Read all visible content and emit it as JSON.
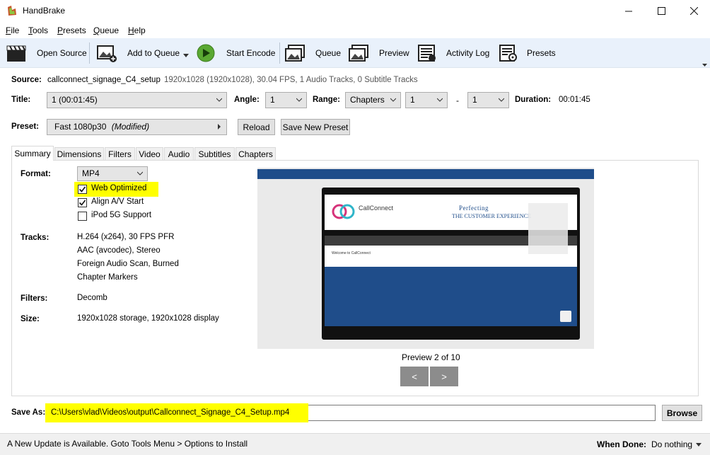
{
  "window": {
    "title": "HandBrake"
  },
  "menu": [
    {
      "label": "File",
      "key": "F",
      "rest": "ile"
    },
    {
      "label": "Tools",
      "key": "T",
      "rest": "ools"
    },
    {
      "label": "Presets",
      "key": "P",
      "rest": "resets"
    },
    {
      "label": "Queue",
      "key": "Q",
      "rest": "ueue"
    },
    {
      "label": "Help",
      "key": "H",
      "rest": "elp"
    }
  ],
  "toolbar": {
    "open_source": "Open Source",
    "add_to_queue": "Add to Queue",
    "start_encode": "Start Encode",
    "queue": "Queue",
    "preview": "Preview",
    "activity_log": "Activity Log",
    "presets": "Presets"
  },
  "source": {
    "label": "Source:",
    "name": "callconnect_signage_C4_setup",
    "details": "1920x1028 (1920x1028), 30.04 FPS, 1 Audio Tracks, 0 Subtitle Tracks"
  },
  "title_row": {
    "title_label": "Title:",
    "title_value": "1  (00:01:45)",
    "angle_label": "Angle:",
    "angle_value": "1",
    "range_label": "Range:",
    "range_value": "Chapters",
    "range_start": "1",
    "range_sep": "-",
    "range_end": "1",
    "duration_label": "Duration:",
    "duration_value": "00:01:45"
  },
  "preset_row": {
    "label": "Preset:",
    "value": "Fast 1080p30",
    "modified": "(Modified)",
    "reload": "Reload",
    "save_new": "Save New Preset"
  },
  "tabs": [
    "Summary",
    "Dimensions",
    "Filters",
    "Video",
    "Audio",
    "Subtitles",
    "Chapters"
  ],
  "summary": {
    "format_label": "Format:",
    "format_value": "MP4",
    "web_optimized": "Web Optimized",
    "align_av": "Align A/V Start",
    "ipod": "iPod 5G Support",
    "tracks_label": "Tracks:",
    "tracks": [
      "H.264 (x264), 30 FPS PFR",
      "AAC (avcodec), Stereo",
      "Foreign Audio Scan, Burned",
      "Chapter Markers"
    ],
    "filters_label": "Filters:",
    "filters_value": "Decomb",
    "size_label": "Size:",
    "size_value": "1920x1028 storage, 1920x1028 display"
  },
  "preview": {
    "caption": "Preview 2 of 10",
    "prev": "<",
    "next": ">",
    "web_title_1": "Perfecting",
    "web_title_2": "the customer experience",
    "brand": "CallConnect",
    "welcome": "Welcome to CallConnect"
  },
  "save_as": {
    "label": "Save As:",
    "path": "C:\\Users\\vlad\\Videos\\output\\Callconnect_Signage_C4_Setup.mp4",
    "browse": "Browse"
  },
  "status": {
    "message": "A New Update is Available. Goto Tools Menu > Options to Install",
    "when_done_label": "When Done:",
    "when_done_value": "Do nothing"
  },
  "colors": {
    "toolbar_bg": "#e9f1fb",
    "highlight": "#ffff00",
    "preview_blue": "#1f4d8a"
  }
}
